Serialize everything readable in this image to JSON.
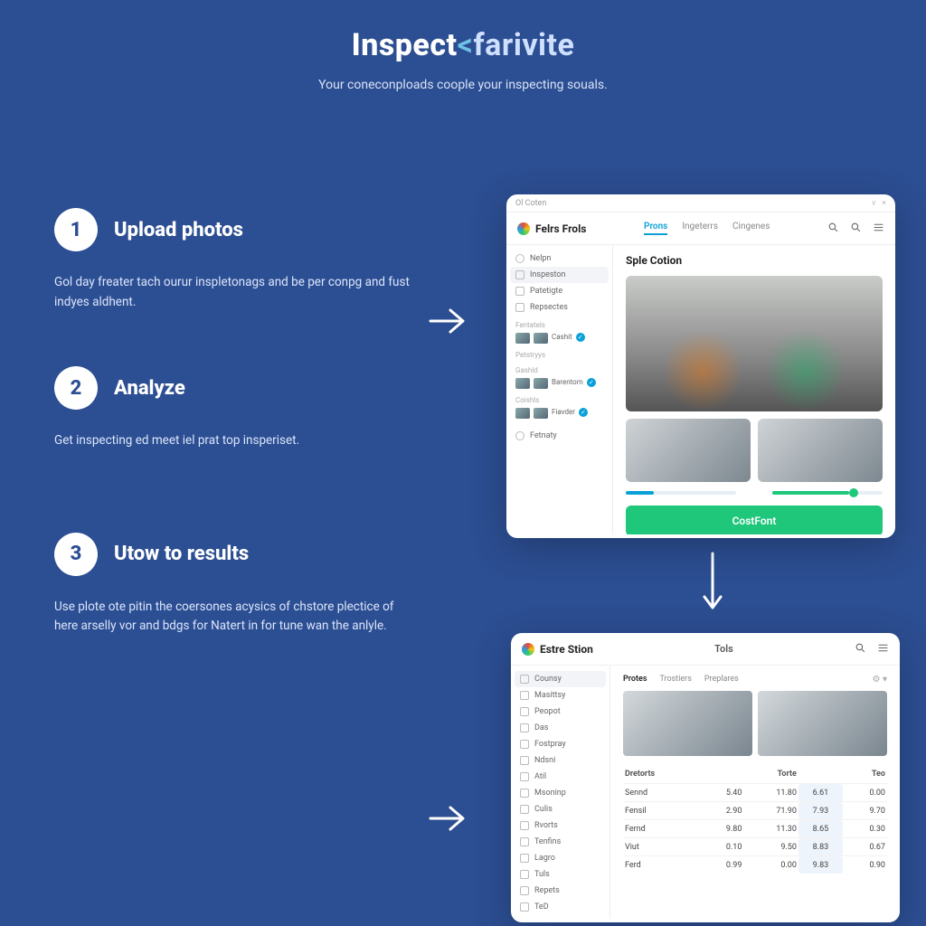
{
  "hero": {
    "title_a": "Inspect",
    "title_sep": "<",
    "title_b": "farivite",
    "subtitle": "Your coneconploads coople your inspecting souals."
  },
  "steps": [
    {
      "num": "1",
      "title": "Upload photos",
      "desc": "Gol day freater tach ourur inspletonags and be per conpg and fust indyes aldhent."
    },
    {
      "num": "2",
      "title": "Analyze",
      "desc": "Get inspecting ed meet iel prat top insperiset."
    },
    {
      "num": "3",
      "title": "Utow to results",
      "desc": "Use plote ote pitin the coersones acysics of chstore plectice of here arselly vor and bdgs for Natert in for tune wan the anlyle."
    }
  ],
  "card1": {
    "titlebar": "Ol Coten",
    "brand": "Felrs Frols",
    "tabs": [
      "Prons",
      "Ingeterrs",
      "Cingenes"
    ],
    "active_tab": 0,
    "heading": "Sple Cotion",
    "sidebar": {
      "items": [
        "Nelpn",
        "Inspeston",
        "Patetigte",
        "Repsectes"
      ],
      "selected": 1,
      "groups": [
        {
          "label": "Fentatels",
          "sub": "Cashit"
        },
        {
          "label": "Petstryys"
        },
        {
          "label": "Gashld",
          "sub": "Barentom"
        },
        {
          "label": "Coishls",
          "sub": "Fiavder"
        }
      ],
      "footer": "Fetnaty"
    },
    "cta": "CostFont"
  },
  "card2": {
    "brand": "Estre Stion",
    "brand2": "Tols",
    "sidebar": [
      "Counsy",
      "Masittsy",
      "Peopot",
      "Das",
      "Fostpray",
      "Ndsni",
      "Atil",
      "Msoninp",
      "Culis",
      "Rvorts",
      "Tenfins",
      "Lagro",
      "Tuls",
      "Repets",
      "TeD"
    ],
    "selected": 0,
    "subtabs": [
      "Protes",
      "Trostiers",
      "Preplares"
    ],
    "table": {
      "headers": [
        "Dretorts",
        "",
        "Torte",
        "",
        "Teo"
      ],
      "rows": [
        [
          "Sennd",
          "5.40",
          "11.80",
          "6.61",
          "0.00"
        ],
        [
          "Fensil",
          "2.90",
          "71.90",
          "7.93",
          "9.70"
        ],
        [
          "Fernd",
          "9.80",
          "11.30",
          "8.65",
          "0.30"
        ],
        [
          "Viut",
          "0.10",
          "9.50",
          "8.83",
          "0.67"
        ],
        [
          "Ferd",
          "0.99",
          "0.00",
          "9.83",
          "0.90"
        ]
      ]
    }
  }
}
